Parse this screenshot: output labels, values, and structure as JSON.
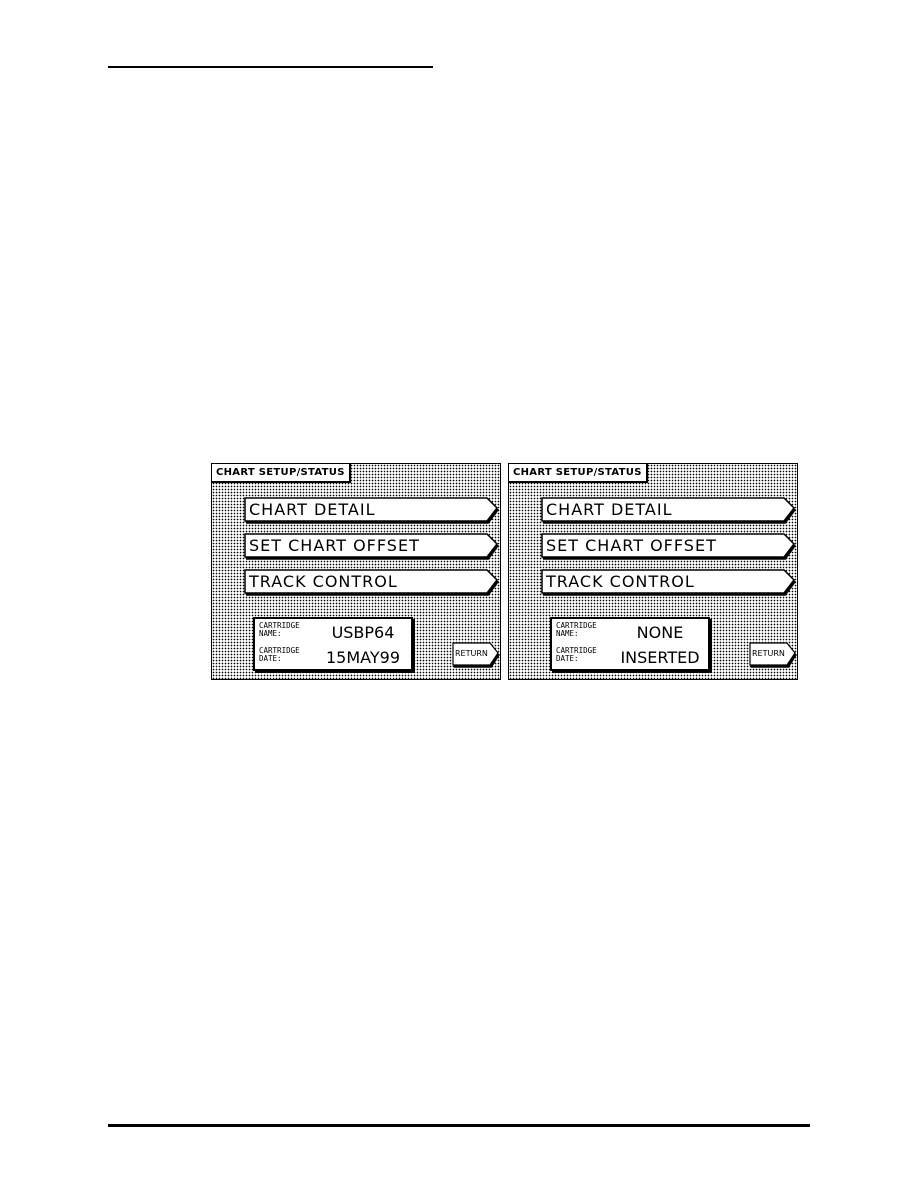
{
  "page": {
    "screens": [
      {
        "title": "CHART SETUP/STATUS",
        "menu": [
          {
            "label": "CHART DETAIL"
          },
          {
            "label": "SET CHART OFFSET"
          },
          {
            "label": "TRACK CONTROL"
          }
        ],
        "cartridge": {
          "name_label": "CARTRIDGE\nNAME:",
          "name_value": "USBP64",
          "date_label": "CARTRIDGE\nDATE:",
          "date_value": "15MAY99"
        },
        "return_label": "RETURN"
      },
      {
        "title": "CHART SETUP/STATUS",
        "menu": [
          {
            "label": "CHART DETAIL"
          },
          {
            "label": "SET CHART OFFSET"
          },
          {
            "label": "TRACK CONTROL"
          }
        ],
        "cartridge": {
          "name_label": "CARTRIDGE\nNAME:",
          "name_value": "NONE",
          "date_label": "CARTRIDGE\nDATE:",
          "date_value": "INSERTED"
        },
        "return_label": "RETURN"
      }
    ]
  }
}
